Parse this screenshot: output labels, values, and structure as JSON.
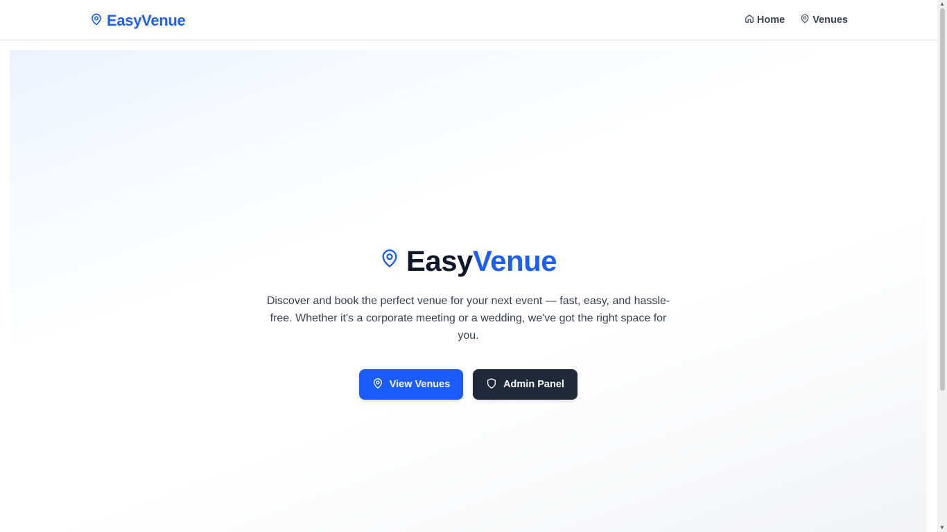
{
  "navbar": {
    "brand": "EasyVenue",
    "brand_icon": "map-pin-icon",
    "links": [
      {
        "label": "Home",
        "icon": "home-icon"
      },
      {
        "label": "Venues",
        "icon": "map-pin-icon"
      }
    ]
  },
  "hero": {
    "title_part1": "Easy",
    "title_part2": "Venue",
    "title_icon": "map-pin-icon",
    "description": "Discover and book the perfect venue for your next event — fast, easy, and hassle-free. Whether it's a corporate meeting or a wedding, we've got the right space for you.",
    "buttons": {
      "primary": {
        "label": "View Venues",
        "icon": "map-pin-icon"
      },
      "secondary": {
        "label": "Admin Panel",
        "icon": "shield-icon"
      }
    }
  },
  "colors": {
    "accent": "#1d5ef5",
    "dark": "#1f2937",
    "title": "#0f172a"
  }
}
